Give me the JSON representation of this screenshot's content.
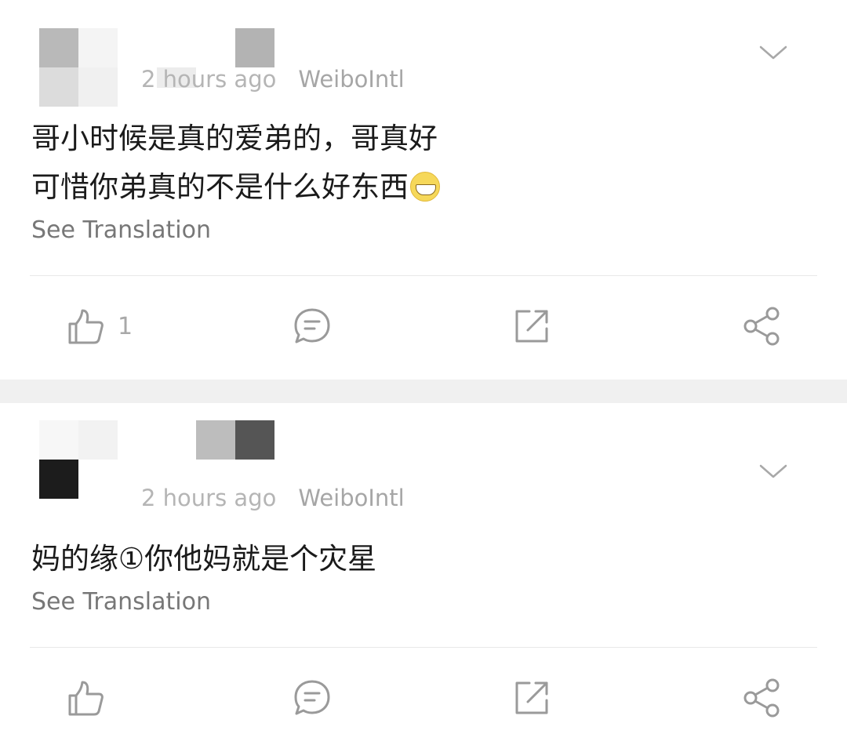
{
  "posts": [
    {
      "meta": {
        "time": "2 hours ago",
        "source": "WeiboIntl"
      },
      "text_lines": [
        "哥小时候是真的爱弟的，哥真好",
        "可惜你弟真的不是什么好东西"
      ],
      "emoji": "grinning-face-emoji",
      "see_translation": "See Translation",
      "actions": {
        "like_count": "1"
      }
    },
    {
      "meta": {
        "time": "2 hours ago",
        "source": "WeiboIntl"
      },
      "text_lines": [
        "妈的缘①你他妈就是个灾星"
      ],
      "see_translation": "See Translation",
      "actions": {
        "like_count": ""
      }
    }
  ],
  "icons": {
    "more": "chevron-down-icon",
    "like": "thumbs-up-icon",
    "comment": "comment-icon",
    "repost": "repost-icon",
    "share": "share-icon"
  },
  "colors": {
    "icon_stroke": "#9a9a9a",
    "text": "#1a1a1a",
    "muted": "#777777",
    "separator": "#f0f0f0"
  }
}
